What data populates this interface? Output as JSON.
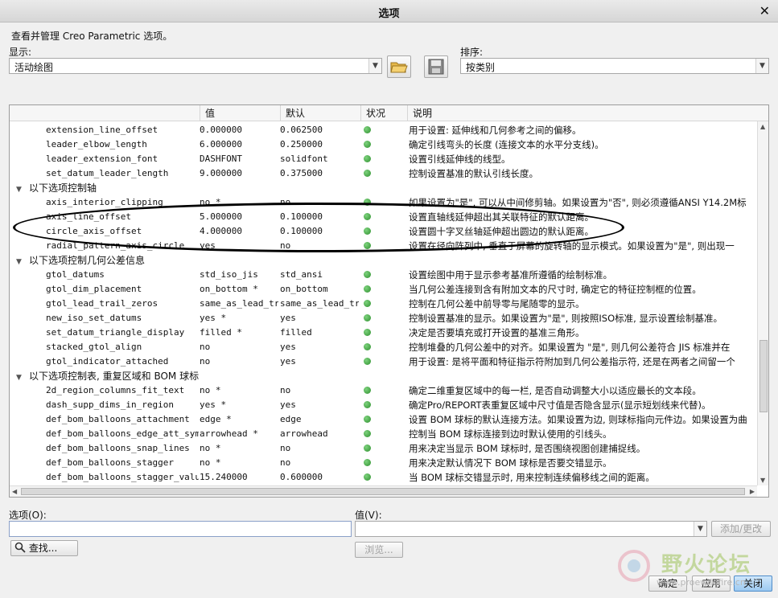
{
  "window": {
    "title": "选项"
  },
  "header": {
    "description": "查看并管理 Creo Parametric 选项。"
  },
  "display": {
    "label": "显示:",
    "value": "活动绘图"
  },
  "sort": {
    "label": "排序:",
    "value": "按类别"
  },
  "table": {
    "columns": [
      "",
      "值",
      "默认",
      "状况",
      "说明"
    ],
    "rows": [
      {
        "type": "item",
        "name": "extension_line_offset",
        "value": "0.000000",
        "default": "0.062500",
        "desc": "用于设置: 延伸线和几何参考之间的偏移。"
      },
      {
        "type": "item",
        "name": "leader_elbow_length",
        "value": "6.000000",
        "default": "0.250000",
        "desc": "确定引线弯头的长度 (连接文本的水平分支线)。"
      },
      {
        "type": "item",
        "name": "leader_extension_font",
        "value": "DASHFONT",
        "default": "solidfont",
        "desc": "设置引线延伸线的线型。"
      },
      {
        "type": "item",
        "name": "set_datum_leader_length",
        "value": "9.000000",
        "default": "0.375000",
        "desc": "控制设置基准的默认引线长度。"
      },
      {
        "type": "group",
        "name": "以下选项控制轴"
      },
      {
        "type": "item",
        "name": "axis_interior_clipping",
        "value": "no *",
        "default": "no",
        "desc": "如果设置为\"是\", 可以从中间修剪轴。如果设置为\"否\", 则必须遵循ANSI Y14.2M标"
      },
      {
        "type": "item",
        "name": "axis_line_offset",
        "value": "5.000000",
        "default": "0.100000",
        "desc": "设置直轴线延伸超出其关联特征的默认距离。"
      },
      {
        "type": "item",
        "name": "circle_axis_offset",
        "value": "4.000000",
        "default": "0.100000",
        "desc": "设置圆十字叉丝轴延伸超出圆边的默认距离。"
      },
      {
        "type": "item",
        "name": "radial_pattern_axis_circle",
        "value": "yes",
        "default": "no",
        "desc": "设置在径向阵列中, 垂直于屏幕的旋转轴的显示模式。如果设置为\"是\", 则出现一"
      },
      {
        "type": "group",
        "name": "以下选项控制几何公差信息"
      },
      {
        "type": "item",
        "name": "gtol_datums",
        "value": "std_iso_jis",
        "default": "std_ansi",
        "desc": "设置绘图中用于显示参考基准所遵循的绘制标准。"
      },
      {
        "type": "item",
        "name": "gtol_dim_placement",
        "value": "on_bottom *",
        "default": "on_bottom",
        "desc": "当几何公差连接到含有附加文本的尺寸时, 确定它的特征控制框的位置。"
      },
      {
        "type": "item",
        "name": "gtol_lead_trail_zeros",
        "value": "same_as_lead_tra",
        "default": "same_as_lead_tra",
        "desc": "控制在几何公差中前导零与尾随零的显示。"
      },
      {
        "type": "item",
        "name": "new_iso_set_datums",
        "value": "yes *",
        "default": "yes",
        "desc": "控制设置基准的显示。如果设置为\"是\", 则按照ISO标准, 显示设置绘制基准。"
      },
      {
        "type": "item",
        "name": "set_datum_triangle_display",
        "value": "filled *",
        "default": "filled",
        "desc": "决定是否要填充或打开设置的基准三角形。"
      },
      {
        "type": "item",
        "name": "stacked_gtol_align",
        "value": "no",
        "default": "yes",
        "desc": "控制堆叠的几何公差中的对齐。如果设置为 \"是\", 则几何公差符合 JIS 标准并在"
      },
      {
        "type": "item",
        "name": "gtol_indicator_attached",
        "value": "no",
        "default": "yes",
        "desc": "用于设置: 是将平面和特征指示符附加到几何公差指示符, 还是在两者之间留一个"
      },
      {
        "type": "group",
        "name": "以下选项控制表, 重复区域和 BOM 球标"
      },
      {
        "type": "item",
        "name": "2d_region_columns_fit_text",
        "value": "no *",
        "default": "no",
        "desc": "确定二维重复区域中的每一栏, 是否自动调整大小以适应最长的文本段。"
      },
      {
        "type": "item",
        "name": "dash_supp_dims_in_region",
        "value": "yes *",
        "default": "yes",
        "desc": "确定Pro/REPORT表重复区域中尺寸值是否隐含显示(显示短划线来代替)。"
      },
      {
        "type": "item",
        "name": "def_bom_balloons_attachment",
        "value": "edge *",
        "default": "edge",
        "desc": "设置 BOM 球标的默认连接方法。如果设置为边, 则球标指向元件边。如果设置为曲"
      },
      {
        "type": "item",
        "name": "def_bom_balloons_edge_att_sym",
        "value": "arrowhead *",
        "default": "arrowhead",
        "desc": "控制当 BOM 球标连接到边时默认使用的引线头。"
      },
      {
        "type": "item",
        "name": "def_bom_balloons_snap_lines",
        "value": "no *",
        "default": "no",
        "desc": "用来决定当显示 BOM 球标时, 是否围绕视图创建捕捉线。"
      },
      {
        "type": "item",
        "name": "def_bom_balloons_stagger",
        "value": "no *",
        "default": "no",
        "desc": "用来决定默认情况下 BOM 球标是否要交错显示。"
      },
      {
        "type": "item",
        "name": "def_bom_balloons_stagger_value",
        "value": "15.240000",
        "default": "0.600000",
        "desc": "当 BOM 球标交错显示时, 用来控制连续偏移线之间的距离。"
      }
    ]
  },
  "option_field": {
    "label": "选项(O):",
    "value": ""
  },
  "value_field": {
    "label": "值(V):",
    "value": ""
  },
  "buttons": {
    "find": "查找...",
    "browse": "浏览...",
    "add_change": "添加/更改",
    "ok": "确定",
    "apply": "应用",
    "close": "关闭"
  },
  "watermark": {
    "title": "野火论坛",
    "url": "www.proewildfire.cn"
  },
  "colors": {
    "status_ok": "#2e8f2e",
    "accent": "#4f8cc9"
  }
}
